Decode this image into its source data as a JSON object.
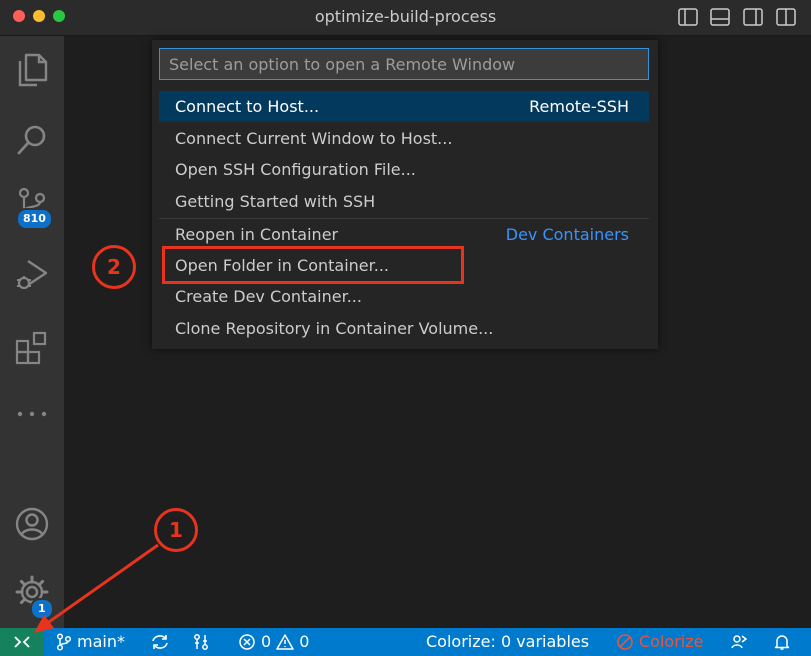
{
  "window": {
    "title": "optimize-build-process"
  },
  "activity_bar": {
    "source_control_badge": "810",
    "settings_badge": "1"
  },
  "quick_pick": {
    "placeholder": "Select an option to open a Remote Window",
    "items": [
      {
        "label": "Connect to Host...",
        "detail": "Remote-SSH"
      },
      {
        "label": "Connect Current Window to Host...",
        "detail": ""
      },
      {
        "label": "Open SSH Configuration File...",
        "detail": ""
      },
      {
        "label": "Getting Started with SSH",
        "detail": ""
      },
      {
        "label": "Reopen in Container",
        "detail": "Dev Containers"
      },
      {
        "label": "Open Folder in Container...",
        "detail": ""
      },
      {
        "label": "Create Dev Container...",
        "detail": ""
      },
      {
        "label": "Clone Repository in Container Volume...",
        "detail": ""
      }
    ]
  },
  "status_bar": {
    "branch": "main*",
    "errors": "0",
    "warnings": "0",
    "colorize_variables": "Colorize: 0 variables",
    "colorize": "Colorize"
  },
  "annotations": {
    "step1": "1",
    "step2": "2"
  },
  "colors": {
    "accent": "#007acc",
    "remote": "#16825d",
    "annotation": "#e8341f",
    "selection": "#04395e",
    "link": "#3794ff"
  }
}
